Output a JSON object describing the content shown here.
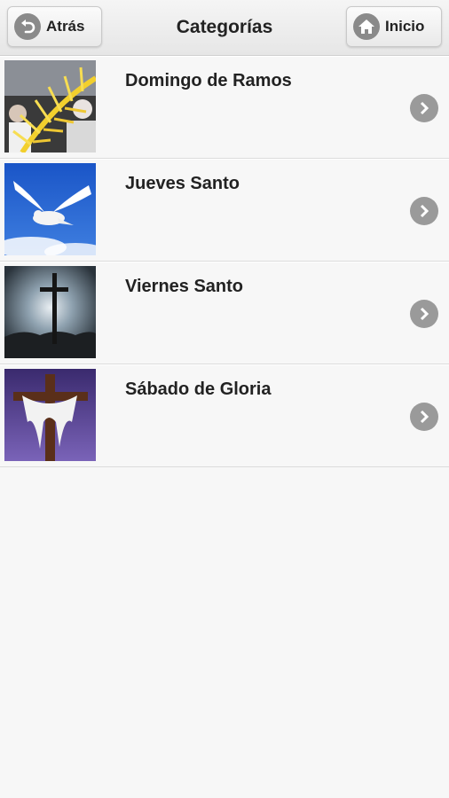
{
  "header": {
    "back_label": "Atrás",
    "title": "Categorías",
    "home_label": "Inicio"
  },
  "categories": [
    {
      "label": "Domingo de Ramos",
      "image": "palm-sunday-photo"
    },
    {
      "label": "Jueves Santo",
      "image": "dove-photo"
    },
    {
      "label": "Viernes Santo",
      "image": "cross-sky-photo"
    },
    {
      "label": "Sábado de Gloria",
      "image": "cross-cloth-photo"
    }
  ],
  "icons": {
    "back": "back-arrow-icon",
    "home": "home-icon",
    "row": "chevron-right-icon"
  },
  "colors": {
    "background": "#f7f7f7",
    "icon_circle": "#8a8a8a"
  }
}
